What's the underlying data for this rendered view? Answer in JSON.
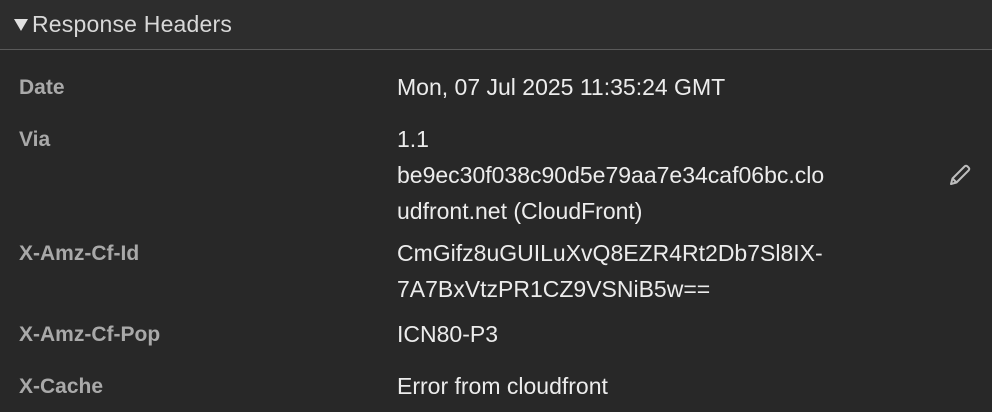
{
  "section": {
    "title": "Response Headers",
    "expanded": true,
    "disclosure_icon": "triangle-down-icon"
  },
  "headers": [
    {
      "name": "Date",
      "value": "Mon, 07 Jul 2025 11:35:24 GMT"
    },
    {
      "name": "Via",
      "value": "1.1 be9ec30f038c90d5e79aa7e34caf06bc.cloudfront.net (CloudFront)",
      "lines": [
        "1.1",
        "be9ec30f038c90d5e79aa7e34caf06bc.clo",
        "udfront.net (CloudFront)"
      ],
      "edit_icon": "pencil-icon"
    },
    {
      "name": "X-Amz-Cf-Id",
      "value": "CmGifz8uGUILuXvQ8EZR4Rt2Db7Sl8IX-7A7BxVtzPR1CZ9VSNiB5w==",
      "lines": [
        "CmGifz8uGUILuXvQ8EZR4Rt2Db7Sl8IX-",
        "7A7BxVtzPR1CZ9VSNiB5w=="
      ]
    },
    {
      "name": "X-Amz-Cf-Pop",
      "value": "ICN80-P3"
    },
    {
      "name": "X-Cache",
      "value": "Error from cloudfront"
    }
  ]
}
